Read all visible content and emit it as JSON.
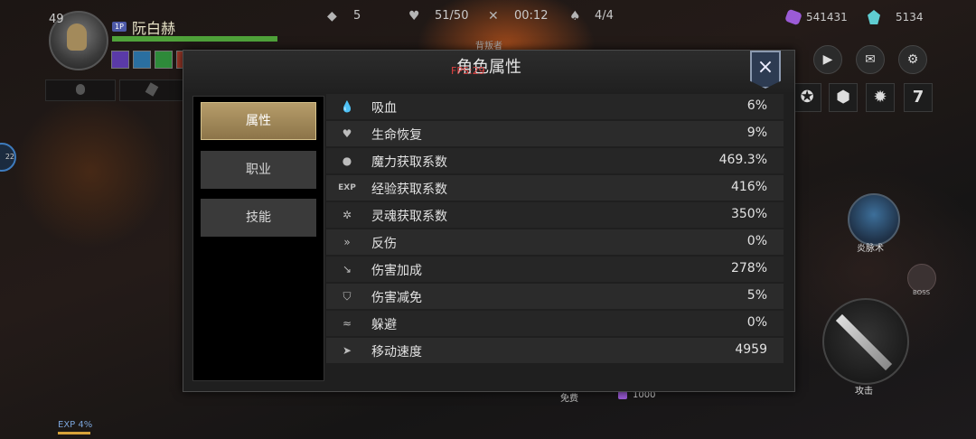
{
  "player": {
    "level": "49",
    "badge": "1P",
    "name": "阮白赫",
    "hp_fraction": 1.0
  },
  "hud": {
    "stats": [
      {
        "icon": "crystal-stack-icon",
        "value": "5"
      },
      {
        "icon": "heart-pulse-icon",
        "value": "51/50"
      },
      {
        "icon": "crossed-swords-icon",
        "value": "00:12"
      },
      {
        "icon": "flame-icon",
        "value": "4/4"
      }
    ],
    "resources": [
      {
        "icon": "purple-gem-icon",
        "value": "541431",
        "color": "#9b5bd6"
      },
      {
        "icon": "teal-crystal-icon",
        "value": "5134",
        "color": "#5fcdd1"
      }
    ]
  },
  "modal": {
    "title": "角色属性",
    "above_title": "背叛者",
    "fps": "FPS:29",
    "close": "×",
    "tabs": [
      {
        "label": "属性",
        "active": true
      },
      {
        "label": "职业",
        "active": false
      },
      {
        "label": "技能",
        "active": false
      }
    ],
    "rows": [
      {
        "icon": "drop-icon",
        "glyph": "💧",
        "label": "吸血",
        "value": "6%"
      },
      {
        "icon": "heart-regen-icon",
        "glyph": "♥",
        "label": "生命恢复",
        "value": "9%"
      },
      {
        "icon": "bomb-icon",
        "glyph": "●",
        "label": "魔力获取系数",
        "value": "469.3%"
      },
      {
        "icon": "exp-icon",
        "glyph": "EXP",
        "label": "经验获取系数",
        "value": "416%"
      },
      {
        "icon": "soul-swirl-icon",
        "glyph": "✲",
        "label": "灵魂获取系数",
        "value": "350%"
      },
      {
        "icon": "reflect-icon",
        "glyph": "»",
        "label": "反伤",
        "value": "0%"
      },
      {
        "icon": "damage-up-icon",
        "glyph": "↘",
        "label": "伤害加成",
        "value": "278%"
      },
      {
        "icon": "shield-icon",
        "glyph": "⛉",
        "label": "伤害减免",
        "value": "5%"
      },
      {
        "icon": "dodge-icon",
        "glyph": "≈",
        "label": "躲避",
        "value": "0%"
      },
      {
        "icon": "boot-icon",
        "glyph": "➤",
        "label": "移动速度",
        "value": "4959"
      }
    ]
  },
  "controls": {
    "skill_label": "炎脉术",
    "boss_label": "BOSS",
    "attack_label": "攻击",
    "round_icons": [
      "play-icon",
      "mail-icon",
      "gear-icon"
    ],
    "square_icons": [
      "rune-icon",
      "hex-icon",
      "gear-wheel-icon",
      "seven-icon"
    ],
    "seven": "7"
  },
  "bottom": {
    "exp_label": "EXP 4%",
    "free_label": "免费",
    "gem_count": "1000"
  },
  "side_bubble": "22"
}
